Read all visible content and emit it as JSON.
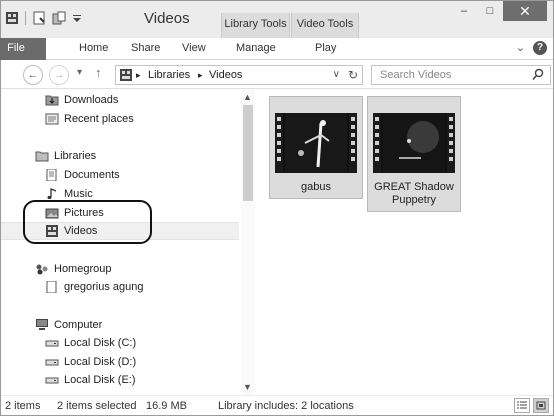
{
  "window": {
    "title": "Videos",
    "context_tabs": [
      "Library Tools",
      "Video Tools"
    ],
    "controls": {
      "minimize": "–",
      "maximize": "□",
      "close": "✕"
    }
  },
  "ribbon": {
    "tabs": [
      "File",
      "Home",
      "Share",
      "View",
      "Manage",
      "Play"
    ],
    "expand": "⌄",
    "help": "?"
  },
  "address": {
    "back": "←",
    "forward": "→",
    "recent": "▾",
    "up": "↑",
    "crumbs": [
      "Libraries",
      "Videos"
    ],
    "separator": "▸",
    "dropdown": "∨",
    "refresh": "↻"
  },
  "search": {
    "placeholder": "Search Videos"
  },
  "nav": {
    "items": [
      {
        "label": "Downloads",
        "icon": "downloads-icon"
      },
      {
        "label": "Recent places",
        "icon": "recent-places-icon"
      },
      {
        "label": "Libraries",
        "icon": "libraries-icon"
      },
      {
        "label": "Documents",
        "icon": "documents-icon"
      },
      {
        "label": "Music",
        "icon": "music-icon"
      },
      {
        "label": "Pictures",
        "icon": "pictures-icon"
      },
      {
        "label": "Videos",
        "icon": "videos-icon",
        "selected": true
      },
      {
        "label": "Homegroup",
        "icon": "homegroup-icon"
      },
      {
        "label": "gregorius agung",
        "icon": "user-icon"
      },
      {
        "label": "Computer",
        "icon": "computer-icon"
      },
      {
        "label": "Local Disk (C:)",
        "icon": "disk-icon"
      },
      {
        "label": "Local Disk (D:)",
        "icon": "disk-icon"
      },
      {
        "label": "Local Disk (E:)",
        "icon": "disk-icon"
      }
    ]
  },
  "files": [
    {
      "name": "gabus"
    },
    {
      "name": "GREAT Shadow Puppetry"
    }
  ],
  "status": {
    "item_count": "2 items",
    "selection": "2 items selected",
    "size": "16.9 MB",
    "library": "Library includes: 2 locations"
  },
  "colors": {
    "title_bar": "#ececec",
    "file_tab": "#6b6b6b",
    "tile_selected": "#dcdcdc"
  }
}
